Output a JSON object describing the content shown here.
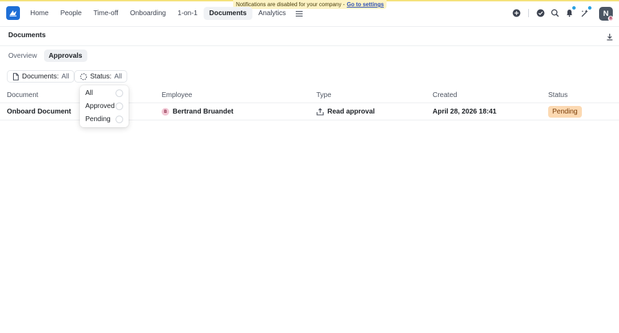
{
  "banner": {
    "text": "Notifications are disabled for your company -",
    "link": "Go to settings"
  },
  "nav": {
    "items": [
      "Home",
      "People",
      "Time-off",
      "Onboarding",
      "1-on-1",
      "Documents",
      "Analytics"
    ],
    "active": "Documents"
  },
  "header_icons": [
    "add-circle-icon",
    "check-circle-icon",
    "search-icon",
    "bell-icon",
    "sparkle-icon"
  ],
  "user": {
    "initial": "N",
    "badge": "B"
  },
  "page": {
    "title": "Documents"
  },
  "tabs": {
    "items": [
      "Overview",
      "Approvals"
    ],
    "active": "Approvals"
  },
  "filters": {
    "documents": {
      "label": "Documents:",
      "value": "All"
    },
    "status": {
      "label": "Status:",
      "value": "All"
    }
  },
  "table": {
    "columns": [
      "Document",
      "Employee",
      "Type",
      "Created",
      "Status"
    ],
    "rows": [
      {
        "document": "Onboard Document",
        "employee": "Bertrand Bruandet",
        "employee_initial": "B",
        "type": "Read approval",
        "created": "April 28, 2026 18:41",
        "status": "Pending"
      }
    ]
  },
  "status_dropdown": {
    "options": [
      "All",
      "Approved",
      "Pending"
    ]
  },
  "colors": {
    "accent": "#1f6fd6",
    "pending_bg": "#fcd9b2",
    "banner_bg": "#fdf3c4",
    "notification_dot": "#2aa0e0"
  }
}
